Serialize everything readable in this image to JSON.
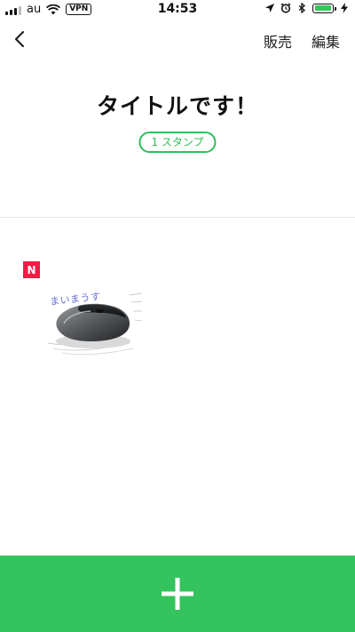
{
  "status_bar": {
    "carrier": "au",
    "vpn": "VPN",
    "time": "14:53"
  },
  "nav": {
    "sell_label": "販売",
    "edit_label": "編集"
  },
  "pack": {
    "title": "タイトルです！",
    "count_label": "1 スタンプ"
  },
  "stickers": [
    {
      "badge": "N",
      "caption": "まいまうす",
      "icon": "computer-mouse"
    }
  ],
  "add_bar": {
    "icon": "plus-icon",
    "color": "#34c35c"
  },
  "colors": {
    "accent": "#2ec05a",
    "new_badge": "#ee1d45"
  }
}
